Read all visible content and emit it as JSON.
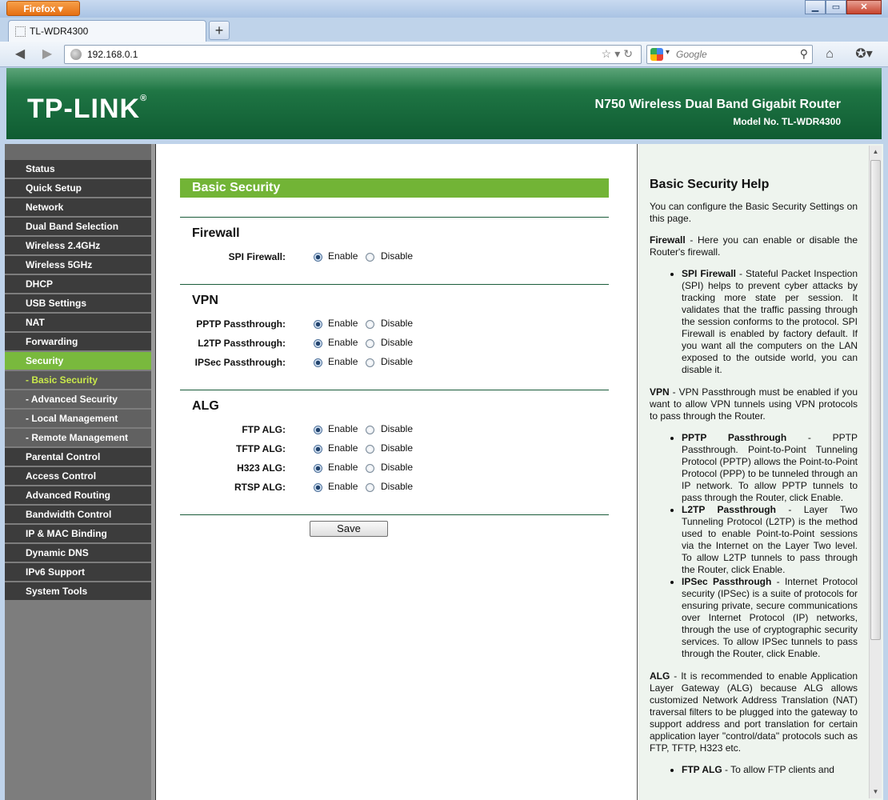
{
  "browser": {
    "menu_label": "Firefox",
    "tab_title": "TL-WDR4300",
    "url": "192.168.0.1",
    "search_placeholder": "Google"
  },
  "header": {
    "logo": "TP-LINK",
    "product": "N750 Wireless Dual Band Gigabit Router",
    "model": "Model No. TL-WDR4300"
  },
  "menu": [
    {
      "label": "Status"
    },
    {
      "label": "Quick Setup"
    },
    {
      "label": "Network"
    },
    {
      "label": "Dual Band Selection"
    },
    {
      "label": "Wireless 2.4GHz"
    },
    {
      "label": "Wireless 5GHz"
    },
    {
      "label": "DHCP"
    },
    {
      "label": "USB Settings"
    },
    {
      "label": "NAT"
    },
    {
      "label": "Forwarding"
    },
    {
      "label": "Security"
    },
    {
      "label": "- Basic Security"
    },
    {
      "label": "- Advanced Security"
    },
    {
      "label": "- Local Management"
    },
    {
      "label": "- Remote Management"
    },
    {
      "label": "Parental Control"
    },
    {
      "label": "Access Control"
    },
    {
      "label": "Advanced Routing"
    },
    {
      "label": "Bandwidth Control"
    },
    {
      "label": "IP & MAC Binding"
    },
    {
      "label": "Dynamic DNS"
    },
    {
      "label": "IPv6 Support"
    },
    {
      "label": "System Tools"
    }
  ],
  "main": {
    "title": "Basic Security",
    "enable": "Enable",
    "disable": "Disable",
    "save": "Save",
    "firewall": {
      "heading": "Firewall",
      "spi": "SPI Firewall:"
    },
    "vpn": {
      "heading": "VPN",
      "pptp": "PPTP Passthrough:",
      "l2tp": "L2TP Passthrough:",
      "ipsec": "IPSec Passthrough:"
    },
    "alg": {
      "heading": "ALG",
      "ftp": "FTP ALG:",
      "tftp": "TFTP ALG:",
      "h323": "H323 ALG:",
      "rtsp": "RTSP ALG:"
    }
  },
  "help": {
    "title": "Basic Security Help",
    "intro": "You can configure the Basic Security Settings on this page.",
    "firewall_term": "Firewall",
    "firewall_text": " - Here you can enable or disable the Router's firewall.",
    "spi_term": "SPI Firewall",
    "spi_text": " - Stateful Packet Inspection (SPI) helps to prevent cyber attacks by tracking more state per session. It validates that the traffic passing through the session conforms to the protocol. SPI Firewall is enabled by factory default. If you want all the computers on the LAN exposed to the outside world, you can disable it.",
    "vpn_term": "VPN",
    "vpn_text": " - VPN Passthrough must be enabled if you want to allow VPN tunnels using VPN protocols to pass through the Router.",
    "pptp_term": "PPTP Passthrough",
    "pptp_text": " - PPTP Passthrough. Point-to-Point Tunneling Protocol (PPTP) allows the Point-to-Point Protocol (PPP) to be tunneled through an IP network. To allow PPTP tunnels to pass through the Router, click Enable.",
    "l2tp_term": "L2TP Passthrough",
    "l2tp_text": " - Layer Two Tunneling Protocol (L2TP) is the method used to enable Point-to-Point sessions via the Internet on the Layer Two level. To allow L2TP tunnels to pass through the Router, click Enable.",
    "ipsec_term": "IPSec Passthrough",
    "ipsec_text": " - Internet Protocol security (IPSec) is a suite of protocols for ensuring private, secure communications over Internet Protocol (IP) networks, through the use of cryptographic security services. To allow IPSec tunnels to pass through the Router, click Enable.",
    "alg_term": "ALG",
    "alg_text": " - It is recommended to enable Application Layer Gateway (ALG) because ALG allows customized Network Address Translation (NAT) traversal filters to be plugged into the gateway to support address and port translation for certain application layer \"control/data\" protocols such as FTP, TFTP, H323 etc.",
    "ftp_term": "FTP ALG",
    "ftp_text": " - To allow FTP clients and"
  }
}
